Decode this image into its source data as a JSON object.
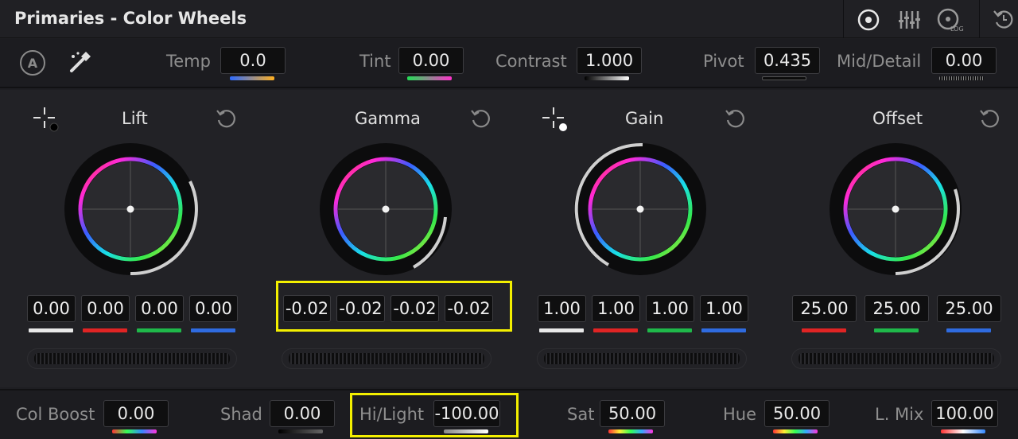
{
  "header": {
    "title": "Primaries - Color Wheels",
    "icons": [
      "color-wheels-icon",
      "primaries-bars-icon",
      "log-wheels-icon",
      "reset-all-icon"
    ]
  },
  "controls": {
    "auto_label": "A",
    "temp": {
      "label": "Temp",
      "value": "0.0"
    },
    "tint": {
      "label": "Tint",
      "value": "0.00"
    },
    "contrast": {
      "label": "Contrast",
      "value": "1.000"
    },
    "pivot": {
      "label": "Pivot",
      "value": "0.435"
    },
    "mid_detail": {
      "label": "Mid/Detail",
      "value": "0.00"
    }
  },
  "wheels": {
    "lift": {
      "name": "Lift",
      "values": [
        "0.00",
        "0.00",
        "0.00",
        "0.00"
      ]
    },
    "gamma": {
      "name": "Gamma",
      "values": [
        "-0.02",
        "-0.02",
        "-0.02",
        "-0.02"
      ]
    },
    "gain": {
      "name": "Gain",
      "values": [
        "1.00",
        "1.00",
        "1.00",
        "1.00"
      ]
    },
    "offset": {
      "name": "Offset",
      "values": [
        "25.00",
        "25.00",
        "25.00"
      ]
    }
  },
  "bottom": {
    "col_boost": {
      "label": "Col Boost",
      "value": "0.00"
    },
    "shad": {
      "label": "Shad",
      "value": "0.00"
    },
    "hi_light": {
      "label": "Hi/Light",
      "value": "-100.00"
    },
    "sat": {
      "label": "Sat",
      "value": "50.00"
    },
    "hue": {
      "label": "Hue",
      "value": "50.00"
    },
    "l_mix": {
      "label": "L. Mix",
      "value": "100.00"
    }
  },
  "colors": {
    "highlight": "#f3ef00",
    "channel_y": "#e8e8e8",
    "channel_r": "#e02424",
    "channel_g": "#1fb84a",
    "channel_b": "#2f6be0"
  }
}
